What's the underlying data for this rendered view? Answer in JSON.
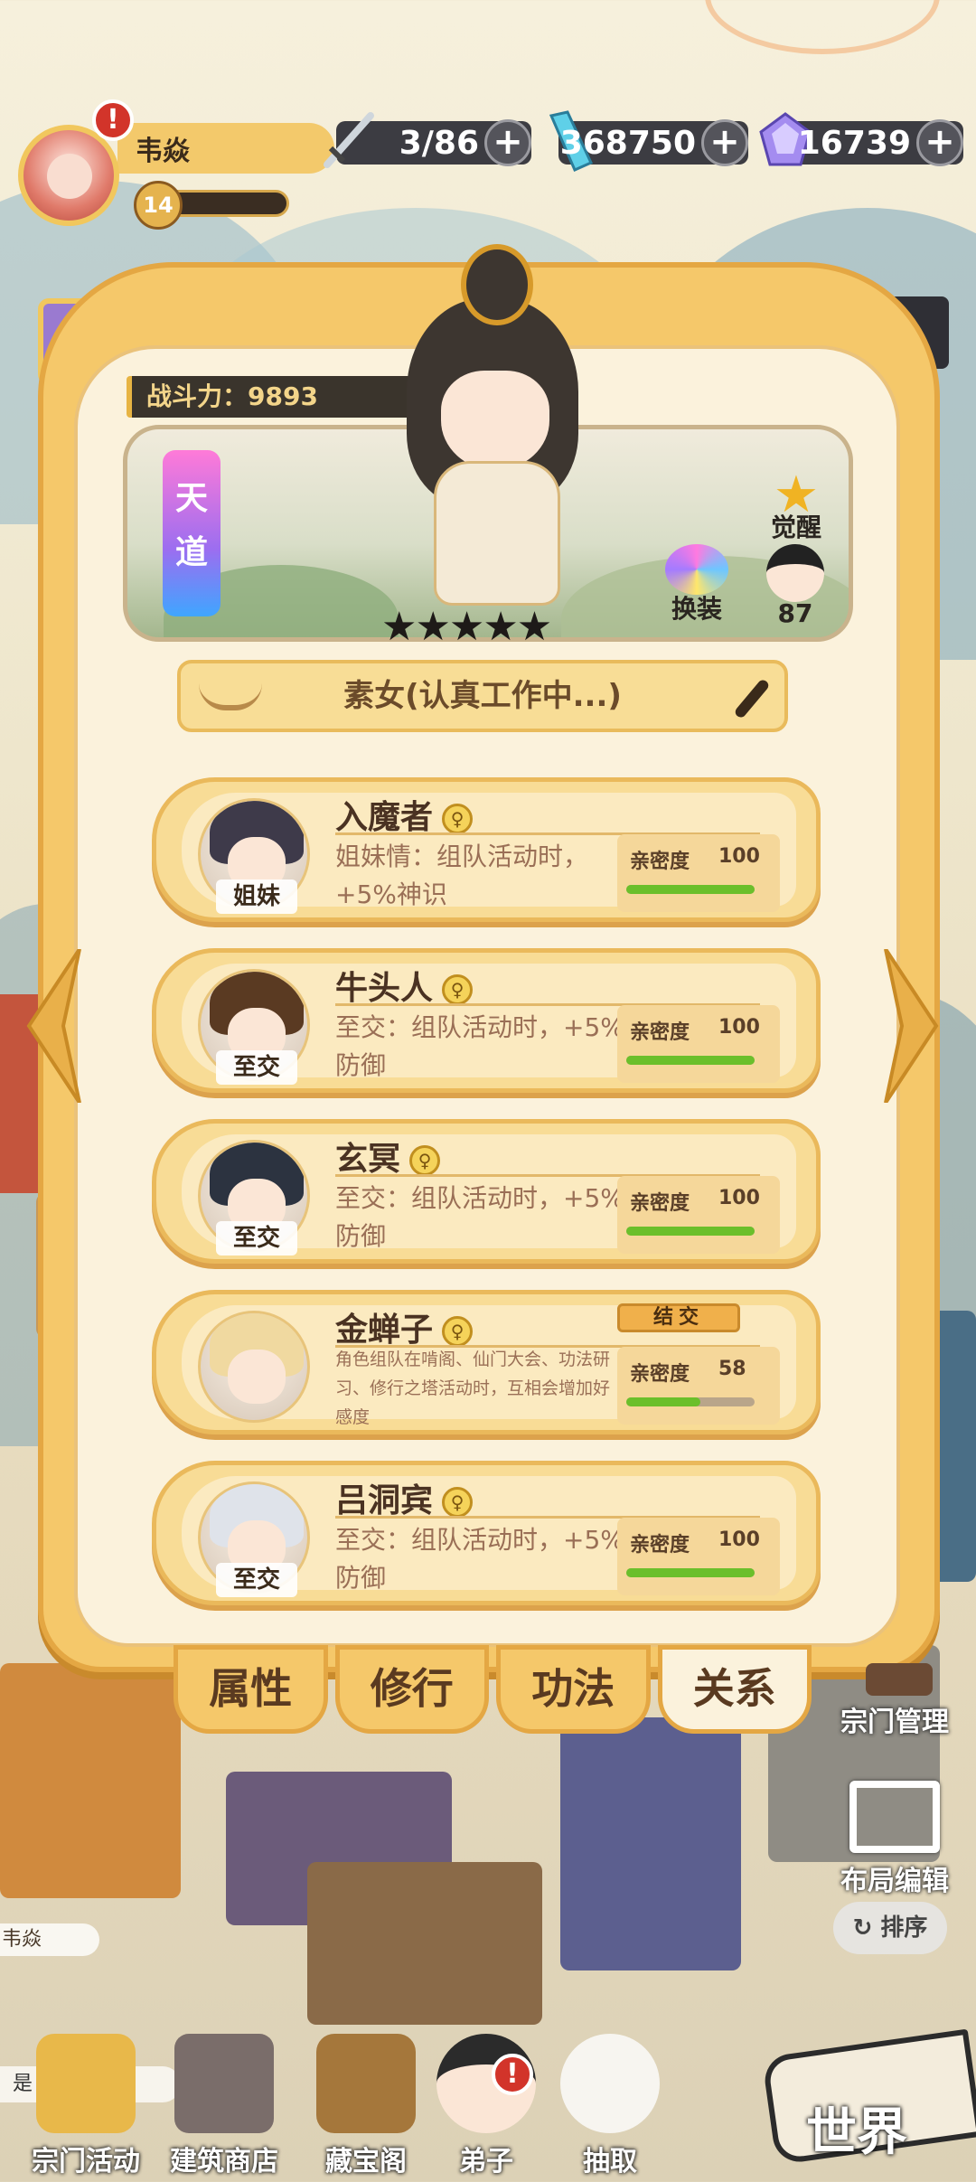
{
  "player": {
    "name": "韦焱",
    "level": "14"
  },
  "resources": [
    {
      "icon": "sword-icon",
      "value": "3/86"
    },
    {
      "icon": "crystal-icon",
      "value": "368750"
    },
    {
      "icon": "gem-icon",
      "value": "16739"
    }
  ],
  "character": {
    "power_label": "战斗力：9893",
    "rank_tag": "天道",
    "stars": "★★★★★",
    "star_count": 5,
    "awaken_label": "觉醒",
    "outfit_label": "换装",
    "follower_count": "87",
    "status": "素女(认真工作中...)"
  },
  "relations": [
    {
      "name": "入魔者",
      "tag": "姐妹",
      "desc": "姐妹情：组队活动时，+5%神识",
      "intimacy_label": "亲密度",
      "intimacy": "100",
      "fill": 1.0,
      "avatar_hair": "#3e3a4a"
    },
    {
      "name": "牛头人",
      "tag": "至交",
      "desc": "至交：组队活动时，+5%防御",
      "intimacy_label": "亲密度",
      "intimacy": "100",
      "fill": 1.0,
      "avatar_hair": "#5a3a22"
    },
    {
      "name": "玄冥",
      "tag": "至交",
      "desc": "至交：组队活动时，+5%防御",
      "intimacy_label": "亲密度",
      "intimacy": "100",
      "fill": 1.0,
      "avatar_hair": "#2c3340"
    },
    {
      "name": "金蝉子",
      "tag": "",
      "badge": "结交",
      "desc": "角色组队在啃阁、仙门大会、功法研习、修行之塔活动时，互相会增加好感度",
      "intimacy_label": "亲密度",
      "intimacy": "58",
      "fill": 0.58,
      "avatar_hair": "#f0d9a0"
    },
    {
      "name": "吕洞宾",
      "tag": "至交",
      "desc": "至交：组队活动时，+5%防御",
      "intimacy_label": "亲密度",
      "intimacy": "100",
      "fill": 1.0,
      "avatar_hair": "#dfe3ea"
    }
  ],
  "tabs": [
    {
      "label": "属性",
      "active": false
    },
    {
      "label": "修行",
      "active": false
    },
    {
      "label": "功法",
      "active": false
    },
    {
      "label": "关系",
      "active": true
    }
  ],
  "side": {
    "sect_manage": "宗门管理",
    "layout_edit": "布局编辑",
    "sort": "排序"
  },
  "chat": {
    "text": "是     急了?",
    "side_name": "韦焱"
  },
  "nav": [
    {
      "label": "宗门活动"
    },
    {
      "label": "建筑商店"
    },
    {
      "label": "藏宝阁"
    },
    {
      "label": "弟子"
    },
    {
      "label": "抽取"
    }
  ],
  "world_label": "世界",
  "colors": {
    "accent": "#f5c86a",
    "intimacy_fill": "#6bbf2b",
    "alert": "#d2342a"
  }
}
